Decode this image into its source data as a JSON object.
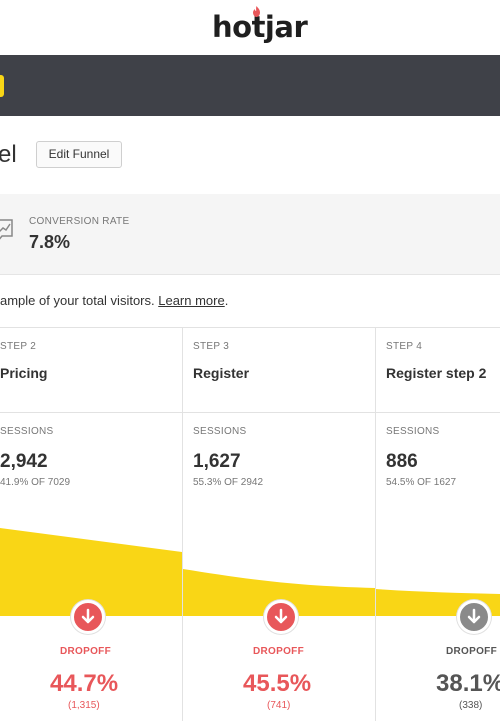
{
  "header": {
    "logo_text": "hotjar"
  },
  "page": {
    "title_fragment": "el",
    "edit_button": "Edit Funnel"
  },
  "stats": {
    "conversion_label": "CONVERSION RATE",
    "conversion_value": "7.8%"
  },
  "notice": {
    "text": "ample of your total visitors. ",
    "link": "Learn more",
    "suffix": "."
  },
  "steps": [
    {
      "step_label": "STEP 2",
      "name": "Pricing",
      "sessions_label": "SESSIONS",
      "sessions": "2,942",
      "sessions_pct": "41.9% OF 7029",
      "dropoff_label": "DROPOFF",
      "dropoff_pct": "44.7%",
      "dropoff_count": "(1,315)",
      "dropoff_color": "#e8575a"
    },
    {
      "step_label": "STEP 3",
      "name": "Register",
      "sessions_label": "SESSIONS",
      "sessions": "1,627",
      "sessions_pct": "55.3% OF 2942",
      "dropoff_label": "DROPOFF",
      "dropoff_pct": "45.5%",
      "dropoff_count": "(741)",
      "dropoff_color": "#e8575a"
    },
    {
      "step_label": "STEP 4",
      "name": "Register step 2",
      "sessions_label": "SESSIONS",
      "sessions": "886",
      "sessions_pct": "54.5% OF 1627",
      "dropoff_label": "DROPOFF",
      "dropoff_pct": "38.1%",
      "dropoff_count": "(338)",
      "dropoff_color": "#8a8a8a"
    }
  ],
  "colors": {
    "accent_yellow": "#f9d616",
    "dark_bar": "#3f4148",
    "dropoff_red": "#e8575a",
    "dropoff_grey": "#8a8a8a"
  },
  "icons": {
    "dropoff": "arrow-down-circle-icon",
    "conversion": "chart-icon",
    "logo_flame": "flame-icon"
  }
}
